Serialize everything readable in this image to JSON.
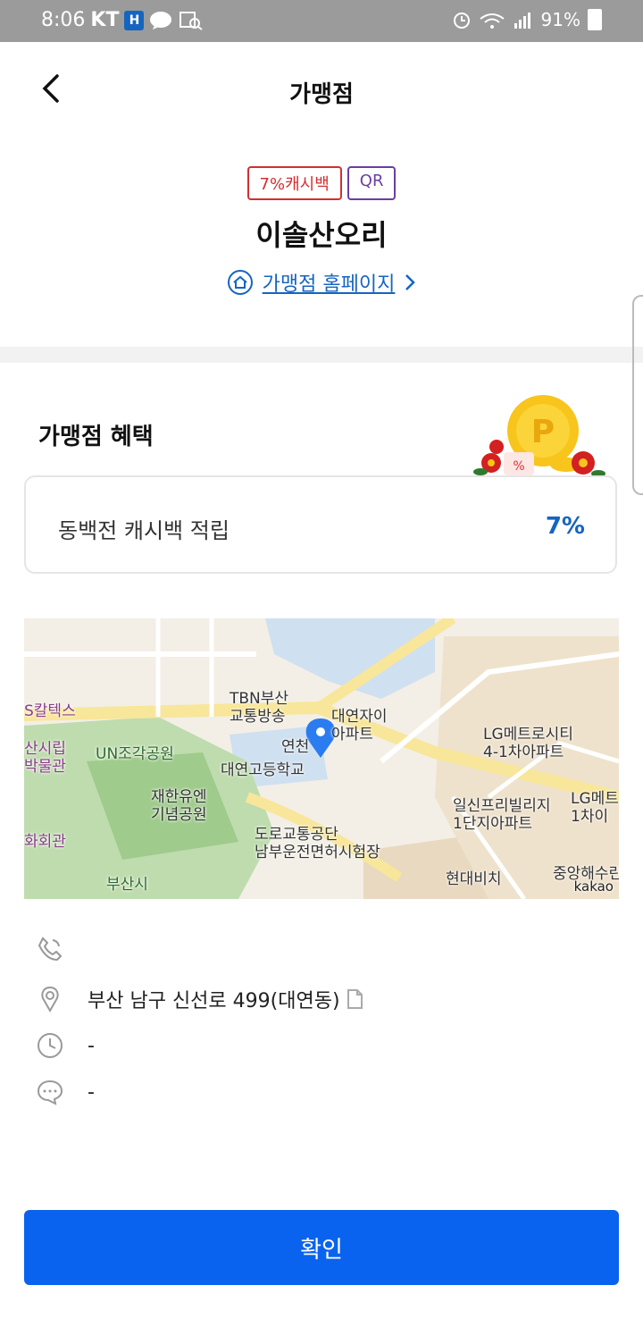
{
  "status_bar": {
    "time": "8:06",
    "carrier": "KT",
    "h_badge": "H",
    "battery": "91%"
  },
  "header": {
    "title": "가맹점"
  },
  "store": {
    "badges": [
      "7%캐시백",
      "QR"
    ],
    "name": "이솔산오리",
    "homepage_link": "가맹점 홈페이지"
  },
  "benefits": {
    "title": "가맹점 혜택",
    "items": [
      {
        "label": "동백전 캐시백 적립",
        "value": "7%"
      }
    ]
  },
  "map": {
    "labels": {
      "tbn": "TBN부산\n교통방송",
      "daeyeon_xi": "대연자이\n아파트",
      "lg_metro": "LG메트로시티\n4-1차아파트",
      "caltex": "S칼텍스",
      "un_park": "UN조각공원",
      "yeoncheon": "연천",
      "daeyeon_high": "대연고등학교",
      "museum": "산시립\n박물관",
      "memorial": "재한유엔\n기념공원",
      "lg_metro2": "LG메트\n1차이",
      "ilshin": "일신프리빌리지\n1단지아파트",
      "road_traffic": "도로교통공단\n남부운전면허시험장",
      "hall": "화회관",
      "busan_si": "부산시",
      "hyundai": "현대비치",
      "jungang": "중앙해수린",
      "brand": "kakao"
    }
  },
  "info": {
    "phone": "",
    "address": "부산 남구 신선로 499(대연동)",
    "hours": "-",
    "note": "-"
  },
  "confirm_label": "확인"
}
